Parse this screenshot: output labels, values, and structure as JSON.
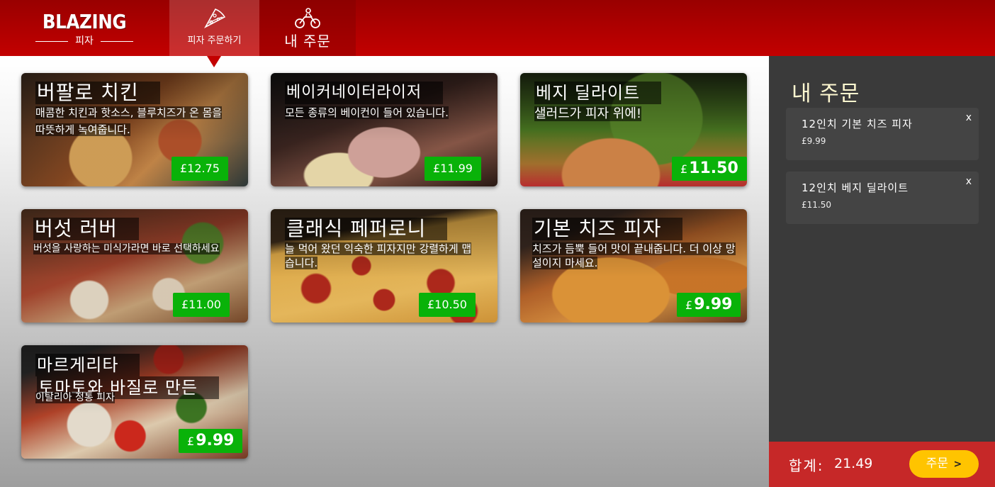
{
  "brand": {
    "logo_main": "BLAZING",
    "logo_sub": "피자"
  },
  "nav": {
    "order_pizza": "피자 주문하기",
    "my_orders": "내 주문"
  },
  "cards": [
    {
      "title": "버팔로 치킨",
      "desc": "매콤한 치킨과 핫소스, 블루치즈가 온 몸을 따뜻하게 녹여줍니다.",
      "price": "£12.75"
    },
    {
      "title": "베이커네이터라이저",
      "desc": "모든 종류의 베이컨이 들어 있습니다.",
      "price": "£11.99"
    },
    {
      "title": "베지 딜라이트",
      "desc": "샐러드가 피자 위에!",
      "currency": "£",
      "price_num": "11.50"
    },
    {
      "title": "버섯 러버",
      "desc": "버섯을 사랑하는 미식가라면 바로 선택하세요",
      "price": "£11.00"
    },
    {
      "title": "클래식 페퍼로니",
      "desc": "늘 먹어 왔던 익숙한 피자지만 강렬하게 맵습니다.",
      "price": "£10.50"
    },
    {
      "title": "기본 치즈 피자",
      "desc": "치즈가 듬뿍 들어 맛이 끝내줍니다. 더 이상 망설이지 마세요.",
      "currency": "£",
      "price_num": "9.99"
    },
    {
      "title": "마르게리타",
      "subtitle": "토마토와 바질로 만든",
      "desc": "이탈리아 정통 피자",
      "currency": "£",
      "price_num": "9.99"
    }
  ],
  "sidebar": {
    "title": "내 주문",
    "items": [
      {
        "name": "12인치 기본 치즈 피자",
        "amount": "£9.99",
        "remove": "x"
      },
      {
        "name": "12인치 베지 딜라이트",
        "amount": "£11.50",
        "remove": "x"
      }
    ],
    "total_label": "합계:",
    "total_value": "21.49",
    "order_button": "주문",
    "order_chevron": ">"
  },
  "colors": {
    "brand_red": "#c30000",
    "price_green": "#09b209",
    "order_yellow": "#ffc400",
    "sidebar_bg": "#3a3a3a"
  }
}
